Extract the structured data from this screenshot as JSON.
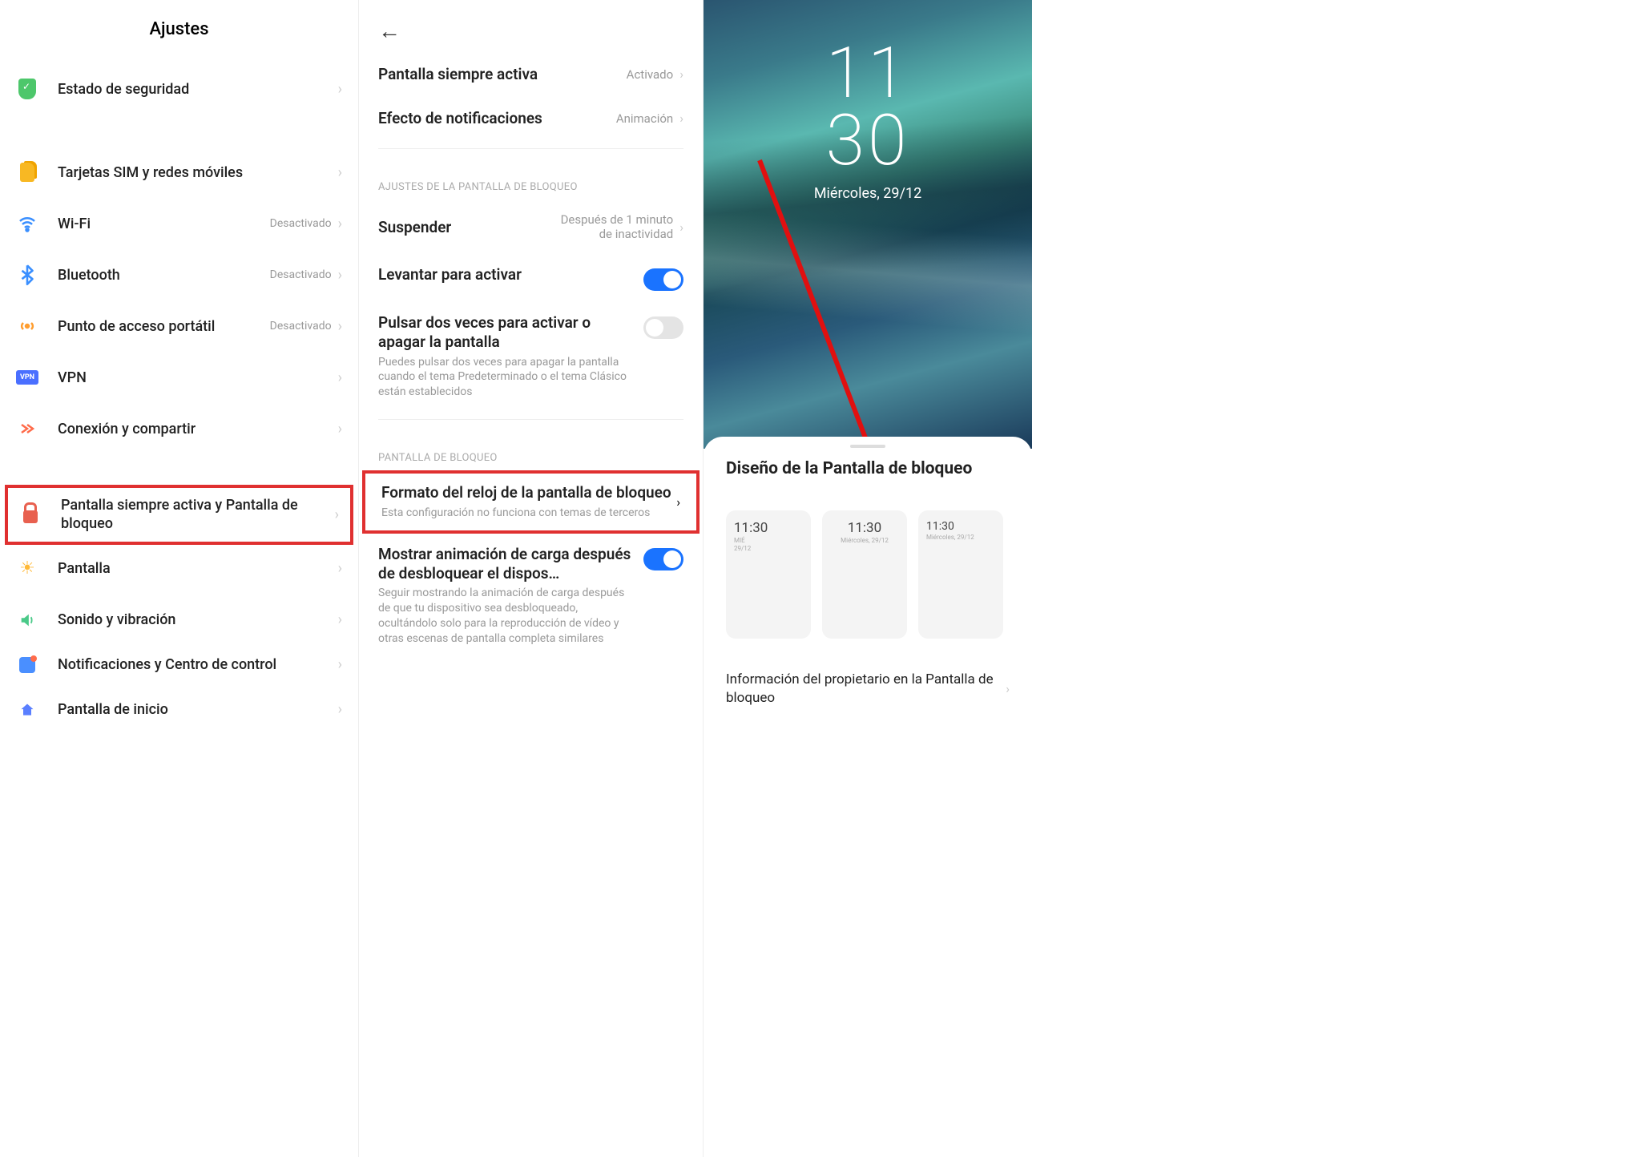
{
  "panel1": {
    "title": "Ajustes",
    "items": [
      {
        "label": "Estado de seguridad"
      },
      {
        "label": "Tarjetas SIM y redes móviles"
      },
      {
        "label": "Wi-Fi",
        "status": "Desactivado"
      },
      {
        "label": "Bluetooth",
        "status": "Desactivado"
      },
      {
        "label": "Punto de acceso portátil",
        "status": "Desactivado"
      },
      {
        "label": "VPN"
      },
      {
        "label": "Conexión y compartir"
      },
      {
        "label": "Pantalla siempre activa y Pantalla de bloqueo"
      },
      {
        "label": "Pantalla"
      },
      {
        "label": "Sonido y vibración"
      },
      {
        "label": "Notificaciones y Centro de control"
      },
      {
        "label": "Pantalla de inicio"
      }
    ]
  },
  "panel2": {
    "aod": {
      "label": "Pantalla siempre activa",
      "value": "Activado"
    },
    "notif_effect": {
      "label": "Efecto de notificaciones",
      "value": "Animación"
    },
    "section1": "AJUSTES DE LA PANTALLA DE BLOQUEO",
    "sleep": {
      "label": "Suspender",
      "value": "Después de 1 minuto de inactividad"
    },
    "raise": {
      "label": "Levantar para activar"
    },
    "doubletap": {
      "title": "Pulsar dos veces para activar o apagar la pantalla",
      "desc": "Puedes pulsar dos veces para apagar la pantalla cuando el tema Predeterminado o el tema Clásico están establecidos"
    },
    "section2": "PANTALLA DE BLOQUEO",
    "clockformat": {
      "title": "Formato del reloj de la pantalla de bloqueo",
      "desc": "Esta configuración no funciona con temas de terceros"
    },
    "charge": {
      "title": "Mostrar animación de carga después de desbloquear el dispos…",
      "desc": "Seguir mostrando la animación de carga después de que tu dispositivo sea desbloqueado, ocultándolo solo para la reproducción de vídeo y otras escenas de pantalla completa similares"
    }
  },
  "panel3": {
    "clock_h": "11",
    "clock_m": "30",
    "date": "Miércoles, 29/12",
    "sheet_title": "Diseño de la Pantalla de bloqueo",
    "layouts": [
      {
        "time": "11:30",
        "line2": "MIÉ",
        "line3": "29/12"
      },
      {
        "time": "11:30",
        "line2": "Miércoles, 29/12"
      },
      {
        "time": "11:30",
        "line2": "Miércoles, 29/12"
      }
    ],
    "owner_info": "Información del propietario en la Pantalla de bloqueo"
  }
}
